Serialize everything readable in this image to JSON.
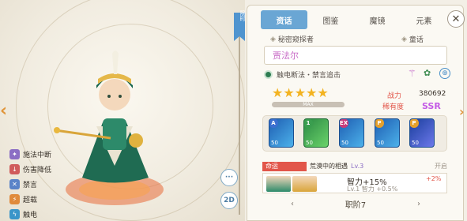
{
  "tabs": [
    "资话",
    "图鉴",
    "魔镜",
    "元素"
  ],
  "side_tag": "限时",
  "close_label": "✕",
  "archetype_label": "秘密窥探者",
  "tale_label": "童话",
  "name": "贾法尔",
  "traits": "触电断法・禁言追击",
  "stars": "★★★★★",
  "max_label": "MAX",
  "power_label": "战力",
  "power_value": "380692",
  "rarity_label": "稀有度",
  "rarity_value": "SSR",
  "skills": [
    {
      "badge": "A",
      "lv": "50"
    },
    {
      "badge": "1",
      "lv": "50"
    },
    {
      "badge": "EX",
      "lv": "50"
    },
    {
      "badge": "P",
      "lv": "50"
    },
    {
      "badge": "P",
      "lv": "50"
    }
  ],
  "fate_tab": "命运",
  "fate_title": "荒漠中的相遇",
  "fate_level": "Lv.3",
  "fate_state": "开启",
  "fate_effect": "智力+15%",
  "fate_effect_detail": "Lv.1 智力 +0.5%",
  "fate_delta": "+2%",
  "stage_label": "职阶7",
  "bottom_prev": "‹",
  "bottom_next": "›",
  "left_skills": [
    "施法中断",
    "伤害降低",
    "禁言",
    "超载",
    "触电"
  ],
  "btn_chat": "···",
  "btn_2d": "2D",
  "colors": {
    "accent": "#6aa6d4",
    "orange": "#e0953a",
    "fate_red": "#e2564a"
  }
}
